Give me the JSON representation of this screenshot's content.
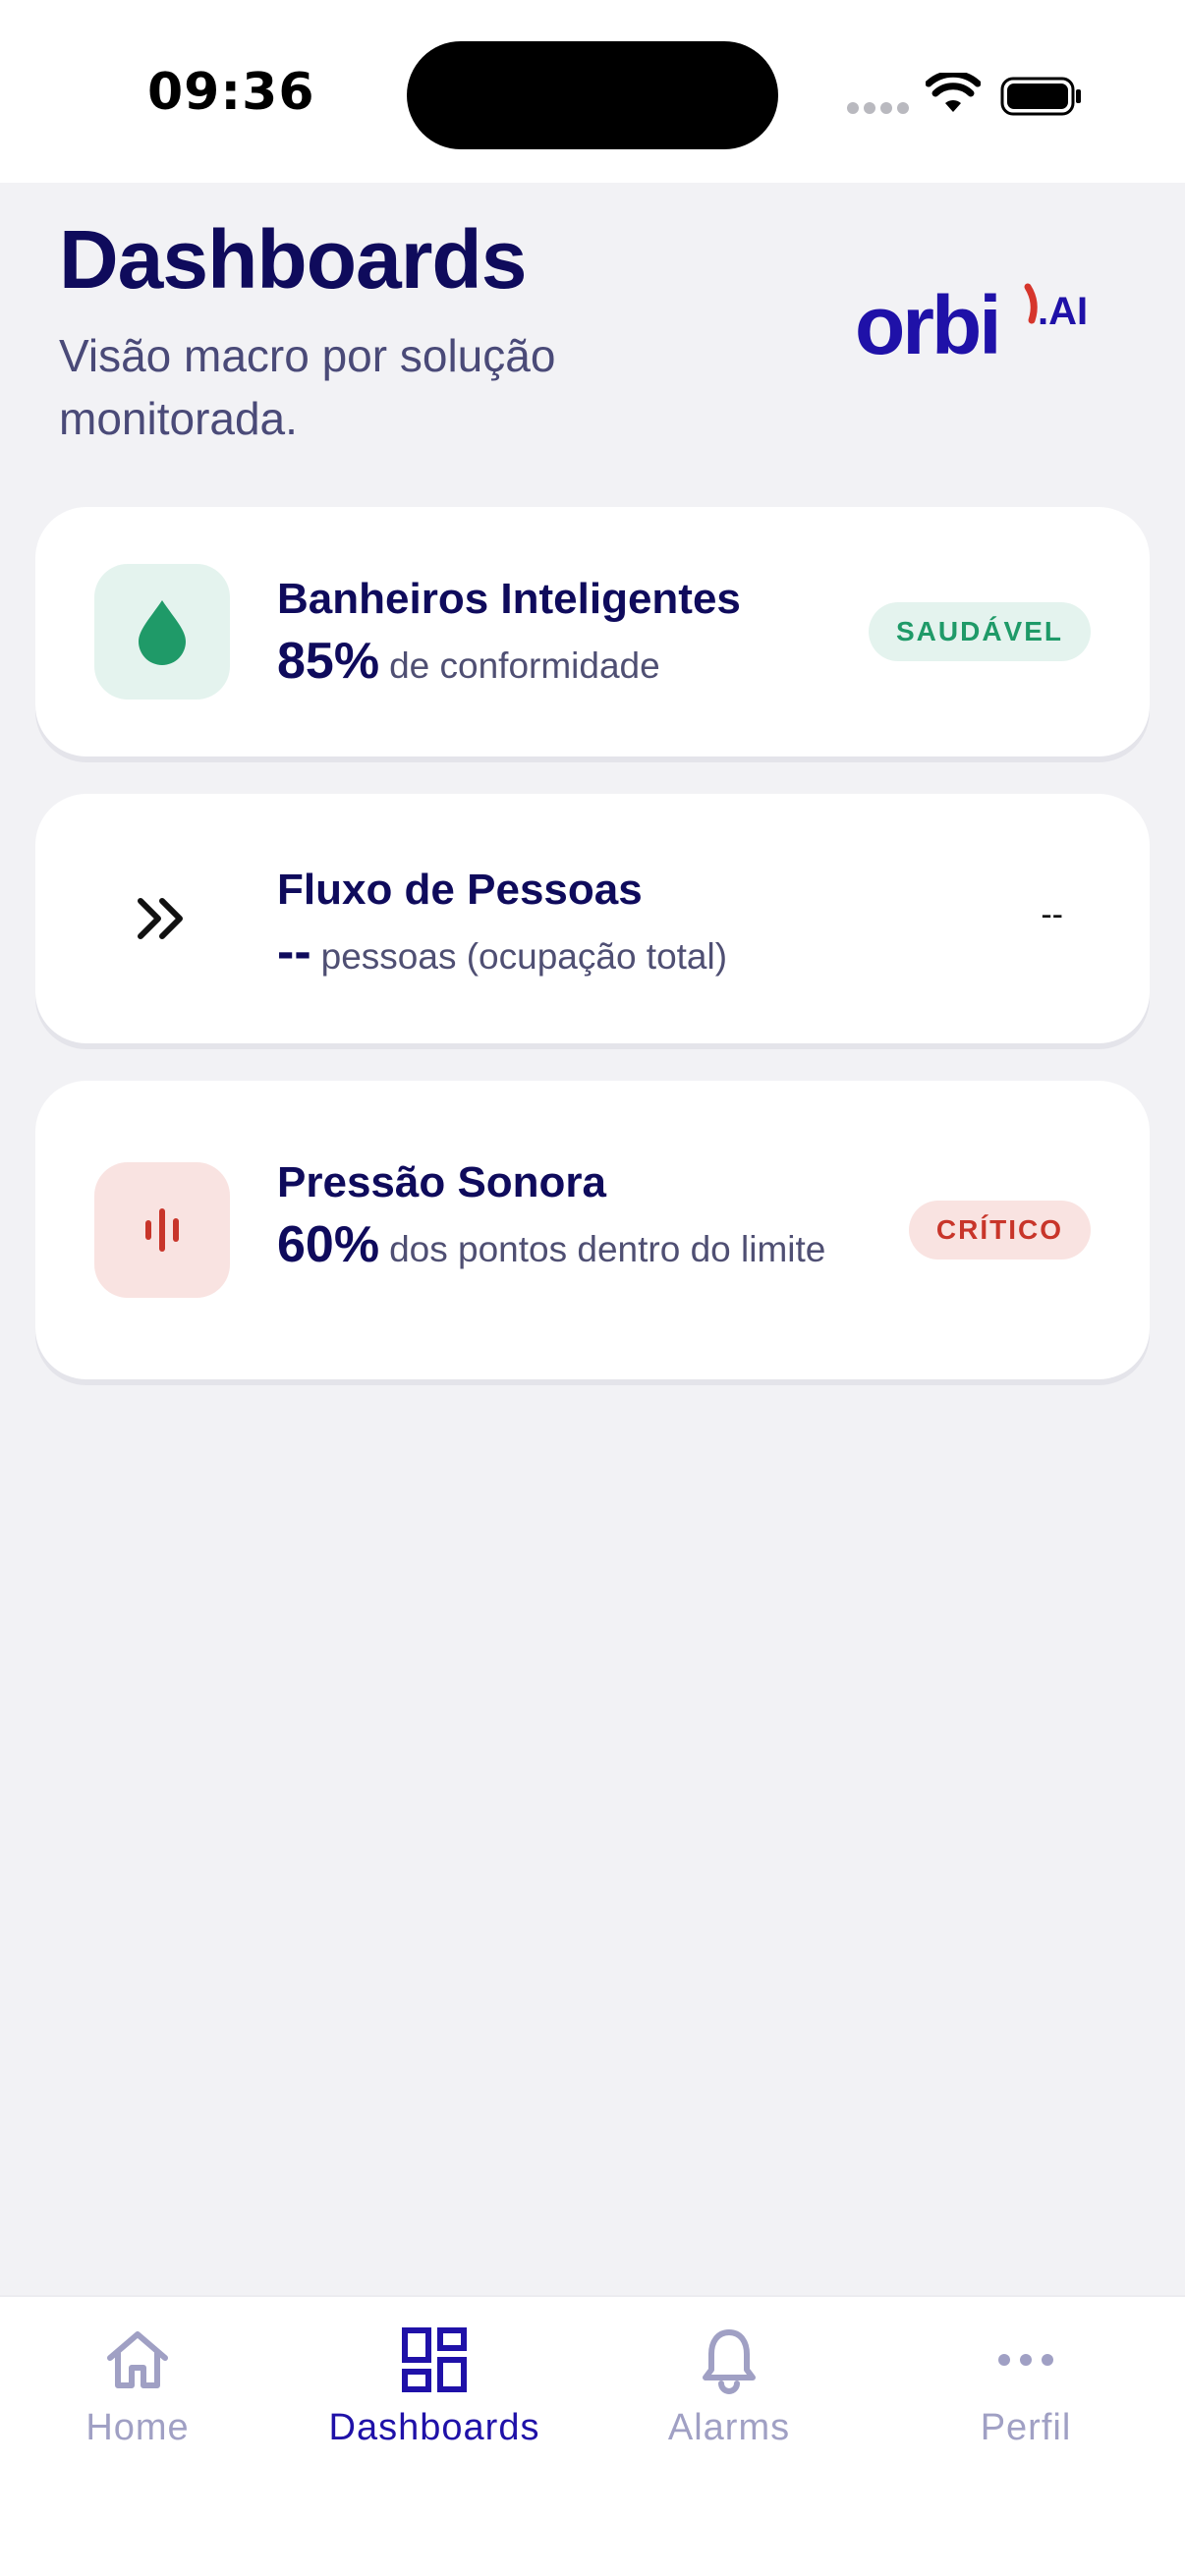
{
  "status_bar": {
    "time": "09:36"
  },
  "header": {
    "title": "Dashboards",
    "subtitle": "Visão macro por solução monitorada.",
    "logo_text": "orbi.AI"
  },
  "cards": [
    {
      "title": "Banheiros Inteligentes",
      "metric_value": "85%",
      "metric_label": "de conformidade",
      "status": "SAUDÁVEL",
      "icon": "water-drop-icon",
      "accent": "#1f9a68"
    },
    {
      "title": "Fluxo de Pessoas",
      "metric_value": "--",
      "metric_label": "pessoas (ocupação total)",
      "status": "--",
      "icon": "chevrons-right-icon"
    },
    {
      "title": "Pressão Sonora",
      "metric_value": "60%",
      "metric_label": "dos pontos dentro do limite",
      "status": "CRÍTICO",
      "icon": "sound-bars-icon",
      "accent": "#c8352a"
    }
  ],
  "tabbar": {
    "items": [
      {
        "label": "Home",
        "icon": "home-icon",
        "active": false
      },
      {
        "label": "Dashboards",
        "icon": "dashboard-grid-icon",
        "active": true
      },
      {
        "label": "Alarms",
        "icon": "bell-icon",
        "active": false
      },
      {
        "label": "Perfil",
        "icon": "more-dots-icon",
        "active": false
      }
    ]
  },
  "colors": {
    "primary": "#0f0b5c",
    "active_tab": "#1f11a8",
    "healthy": "#1f9a68",
    "critical": "#c8352a",
    "background": "#f2f2f5"
  }
}
